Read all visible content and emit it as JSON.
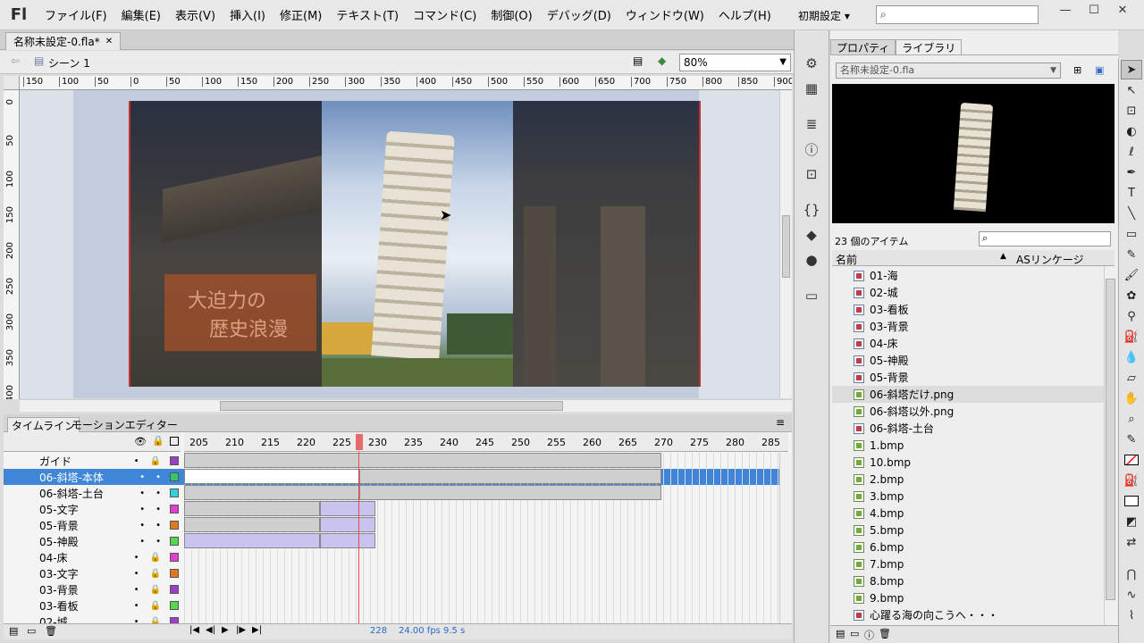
{
  "menu": {
    "logo": "Fl",
    "items": [
      "ファイル(F)",
      "編集(E)",
      "表示(V)",
      "挿入(I)",
      "修正(M)",
      "テキスト(T)",
      "コマンド(C)",
      "制御(O)",
      "デバッグ(D)",
      "ウィンドウ(W)",
      "ヘルプ(H)"
    ],
    "workspace": "初期設定 ▾"
  },
  "document": {
    "tab_title": "名称未設定-0.fla*",
    "scene": "シーン 1",
    "zoom": "80%"
  },
  "ruler": {
    "h_ticks": [
      "150",
      "100",
      "50",
      "0",
      "50",
      "100",
      "150",
      "200",
      "250",
      "300",
      "350",
      "400",
      "450",
      "500",
      "550",
      "600",
      "650",
      "700",
      "750",
      "800",
      "850",
      "900"
    ],
    "v_ticks": [
      "0",
      "50",
      "100",
      "150",
      "200",
      "250",
      "300",
      "350",
      "400"
    ]
  },
  "stage": {
    "overlay_text_line1": "大迫力の",
    "overlay_text_line2": "歴史浪漫"
  },
  "timeline": {
    "tabs": [
      "タイムライン",
      "モーションエディター"
    ],
    "frame_numbers": [
      "205",
      "210",
      "215",
      "220",
      "225",
      "230",
      "235",
      "240",
      "245",
      "250",
      "255",
      "260",
      "265",
      "270",
      "275",
      "280",
      "285"
    ],
    "current_frame": "228",
    "fps": "24.00 fps",
    "time": "9.5 s",
    "layers": [
      {
        "name": "ガイド",
        "color": "#9b3fc8"
      },
      {
        "name": "06-斜塔-本体",
        "color": "#36c46a",
        "selected": true
      },
      {
        "name": "06-斜塔-土台",
        "color": "#36d0d8"
      },
      {
        "name": "05-文字",
        "color": "#e23fd0"
      },
      {
        "name": "05-背景",
        "color": "#e07a1a"
      },
      {
        "name": "05-神殿",
        "color": "#55d84a"
      },
      {
        "name": "04-床",
        "color": "#e23fd0"
      },
      {
        "name": "03-文字",
        "color": "#e07a1a"
      },
      {
        "name": "03-背景",
        "color": "#9b3fc8"
      },
      {
        "name": "03-看板",
        "color": "#55d84a"
      },
      {
        "name": "02-城",
        "color": "#9b3fc8"
      }
    ]
  },
  "library": {
    "tabs": [
      "プロパティ",
      "ライブラリ"
    ],
    "doc_select": "名称未設定-0.fla",
    "item_count": "23 個のアイテム",
    "columns": [
      "名前",
      "ASリンケージ"
    ],
    "items": [
      {
        "name": "01-海",
        "kind": "sym"
      },
      {
        "name": "02-城",
        "kind": "sym"
      },
      {
        "name": "03-看板",
        "kind": "sym"
      },
      {
        "name": "03-背景",
        "kind": "sym"
      },
      {
        "name": "04-床",
        "kind": "sym"
      },
      {
        "name": "05-神殿",
        "kind": "sym"
      },
      {
        "name": "05-背景",
        "kind": "sym"
      },
      {
        "name": "06-斜塔だけ.png",
        "kind": "bmp",
        "selected": true
      },
      {
        "name": "06-斜塔以外.png",
        "kind": "bmp"
      },
      {
        "name": "06-斜塔-土台",
        "kind": "sym"
      },
      {
        "name": "1.bmp",
        "kind": "bmp"
      },
      {
        "name": "10.bmp",
        "kind": "bmp"
      },
      {
        "name": "2.bmp",
        "kind": "bmp"
      },
      {
        "name": "3.bmp",
        "kind": "bmp"
      },
      {
        "name": "4.bmp",
        "kind": "bmp"
      },
      {
        "name": "5.bmp",
        "kind": "bmp"
      },
      {
        "name": "6.bmp",
        "kind": "bmp"
      },
      {
        "name": "7.bmp",
        "kind": "bmp"
      },
      {
        "name": "8.bmp",
        "kind": "bmp"
      },
      {
        "name": "9.bmp",
        "kind": "bmp"
      },
      {
        "name": "心躍る海の向こうへ・・・",
        "kind": "sym"
      }
    ]
  },
  "colors": {
    "selected_layer": "#3f86d8",
    "playhead": "#e84a4a",
    "tween": "#c9c4ef"
  }
}
